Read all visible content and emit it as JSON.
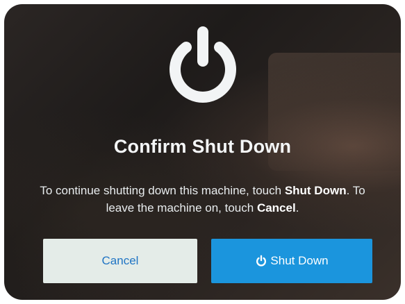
{
  "dialog": {
    "title": "Confirm Shut Down",
    "message_parts": {
      "p1": "To continue shutting down this machine, touch ",
      "p2": "Shut Down",
      "p3": ". To leave the machine on, touch ",
      "p4": "Cancel",
      "p5": "."
    },
    "icon": "power-icon"
  },
  "buttons": {
    "cancel_label": "Cancel",
    "shutdown_label": "Shut Down",
    "shutdown_icon": "power-icon"
  },
  "colors": {
    "screen_background": "#231f1d",
    "text": "#f4f6f7",
    "cancel_button_bg": "#e4ece8",
    "cancel_button_text": "#1f74c4",
    "shutdown_button_bg": "#1b95dd",
    "shutdown_button_text": "#ffffff"
  }
}
